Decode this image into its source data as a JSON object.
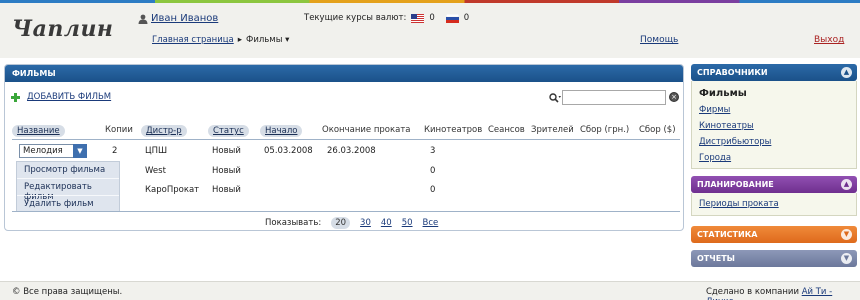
{
  "header": {
    "logo": "Чаплин",
    "user_name": "Иван Иванов",
    "rates_label": "Текущие курсы валют:",
    "usd_value": "0",
    "rub_value": "0",
    "breadcrumb_home": "Главная страница",
    "breadcrumb_sep": "▸",
    "breadcrumb_current": "Фильмы ▾",
    "help": "Помощь",
    "logout": "Выход"
  },
  "panel": {
    "title": "ФИЛЬМЫ",
    "add_film": "ДОБАВИТЬ ФИЛЬМ",
    "search_value": ""
  },
  "table": {
    "columns": [
      "Название",
      "Копии",
      "Дистр-р",
      "Статус",
      "Начало",
      "Окончание проката",
      "Кинотеатров",
      "Сеансов",
      "Зрителей",
      "Сбор (грн.)",
      "Сбор ($)"
    ],
    "select_value": "Мелодия",
    "rows": [
      {
        "copies": "2",
        "distributor": "ЦПШ",
        "status": "Новый",
        "start": "05.03.2008",
        "end": "26.03.2008",
        "cinemas": "3"
      },
      {
        "copies": "",
        "distributor": "West",
        "status": "Новый",
        "start": "",
        "end": "",
        "cinemas": "0"
      },
      {
        "copies": "",
        "distributor": "КароПрокат",
        "status": "Новый",
        "start": "",
        "end": "",
        "cinemas": "0"
      }
    ],
    "menu": [
      "Просмотр фильма",
      "Редактировать фильм",
      "Удалить фильм"
    ]
  },
  "pager": {
    "label": "Показывать:",
    "options": [
      "20",
      "30",
      "40",
      "50",
      "Все"
    ],
    "selected": "20"
  },
  "sidebar": {
    "directories": {
      "title": "СПРАВОЧНИКИ",
      "current": "Фильмы",
      "links": [
        "Фирмы",
        "Кинотеатры",
        "Дистрибьюторы",
        "Города"
      ]
    },
    "planning": {
      "title": "ПЛАНИРОВАНИЕ",
      "links": [
        "Периоды проката"
      ]
    },
    "stats": {
      "title": "СТАТИСТИКА"
    },
    "reports": {
      "title": "ОТЧЕТЫ"
    },
    "colors": {
      "directories": "#1b5b97",
      "planning": "#7d3b9e",
      "stats": "#e8782a",
      "reports": "#7a86a8"
    }
  },
  "footer": {
    "copyright": "© Все права защищены.",
    "made_prefix": "Сделано в компании",
    "company": "Ай Ти - Линкс"
  }
}
